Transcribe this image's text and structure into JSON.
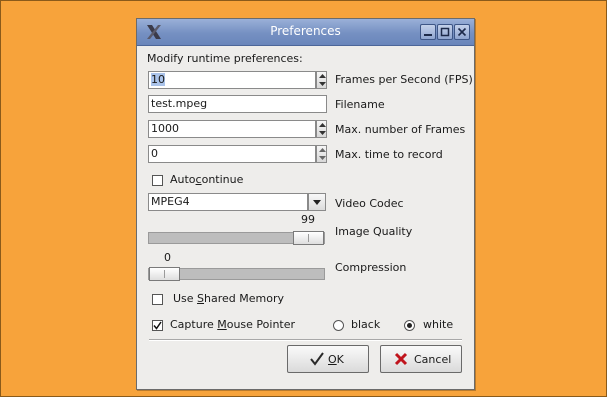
{
  "window": {
    "title": "Preferences",
    "heading": "Modify runtime preferences:"
  },
  "fields": {
    "fps": {
      "value": "10",
      "label": "Frames per Second (FPS)"
    },
    "filename": {
      "value": "test.mpeg",
      "label": "Filename"
    },
    "max_frames": {
      "value": "1000",
      "label": "Max. number of Frames"
    },
    "max_time": {
      "value": "0",
      "label": "Max. time to record"
    }
  },
  "autocontinue": {
    "label_pre": "Auto",
    "label_u": "c",
    "label_post": "ontinue",
    "checked": false
  },
  "video_codec": {
    "value": "MPEG4",
    "label": "Video Codec"
  },
  "image_quality": {
    "value": "99",
    "label": "Image Quality",
    "level": 0.99
  },
  "compression": {
    "value": "0",
    "label": "Compression",
    "level": 0.0
  },
  "shared_memory": {
    "label_pre": "Use ",
    "label_u": "S",
    "label_post": "hared Memory",
    "checked": false
  },
  "capture_mouse": {
    "label_pre": "Capture ",
    "label_u": "M",
    "label_post": "ouse Pointer",
    "checked": true
  },
  "pointer_color": {
    "options": [
      {
        "label": "black",
        "selected": false
      },
      {
        "label": "white",
        "selected": true
      }
    ]
  },
  "buttons": {
    "ok": {
      "label_u": "O",
      "label_post": "K"
    },
    "cancel": {
      "label": "Cancel"
    }
  },
  "icons": {
    "app": "x-logo-icon",
    "minimize": "minimize-icon",
    "maximize": "maximize-icon",
    "close": "close-icon",
    "ok": "check-icon",
    "cancel": "x-icon"
  },
  "colors": {
    "background": "#f7a33b",
    "titlebar": "#7a93c4",
    "dialog": "#eeedeb"
  }
}
